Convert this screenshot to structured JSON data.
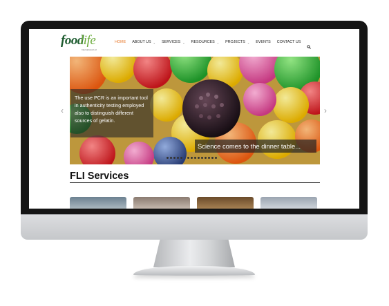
{
  "header": {
    "logo_food": "food",
    "logo_life": "life",
    "logo_sub": "International Ltd"
  },
  "nav": {
    "items": [
      {
        "label": "HOME",
        "active": true,
        "dropdown": false
      },
      {
        "label": "ABOUT US",
        "active": false,
        "dropdown": true
      },
      {
        "label": "SERVICES",
        "active": false,
        "dropdown": true
      },
      {
        "label": "RESOURCES",
        "active": false,
        "dropdown": true
      },
      {
        "label": "PROJECTS",
        "active": false,
        "dropdown": true
      },
      {
        "label": "EVENTS",
        "active": false,
        "dropdown": false
      },
      {
        "label": "CONTACT US",
        "active": false,
        "dropdown": false
      }
    ],
    "search_icon": "search-icon",
    "active_color": "#e8782a"
  },
  "slider": {
    "caption_main": "The use PCR is an important tool in authenticity testing employed also to distinguish different sources of gelatin.",
    "caption_secondary": "Science comes to the dinner table...",
    "prev_arrow": "‹",
    "next_arrow": "›",
    "slide_count": 14,
    "current_slide": 1
  },
  "services": {
    "title": "FLI Services"
  }
}
